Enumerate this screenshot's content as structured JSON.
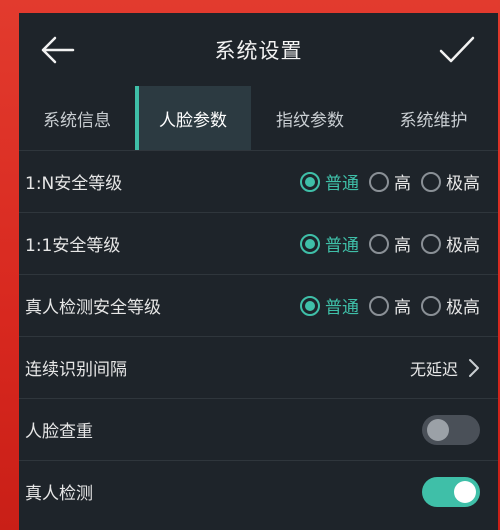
{
  "header": {
    "title": "系统设置"
  },
  "tabs": [
    {
      "label": "系统信息",
      "active": false
    },
    {
      "label": "人脸参数",
      "active": true
    },
    {
      "label": "指纹参数",
      "active": false
    },
    {
      "label": "系统维护",
      "active": false
    }
  ],
  "settings": {
    "n_security": {
      "label": "1:N安全等级",
      "options": [
        "普通",
        "高",
        "极高"
      ],
      "selected": "普通"
    },
    "one_security": {
      "label": "1:1安全等级",
      "options": [
        "普通",
        "高",
        "极高"
      ],
      "selected": "普通"
    },
    "liveness_security": {
      "label": "真人检测安全等级",
      "options": [
        "普通",
        "高",
        "极高"
      ],
      "selected": "普通"
    },
    "interval": {
      "label": "连续识别间隔",
      "value": "无延迟"
    },
    "face_dedup": {
      "label": "人脸查重",
      "enabled": false
    },
    "liveness": {
      "label": "真人检测",
      "enabled": true
    }
  },
  "colors": {
    "accent": "#3fbfa8",
    "background": "#1e242a",
    "outer": "#d8281f"
  }
}
